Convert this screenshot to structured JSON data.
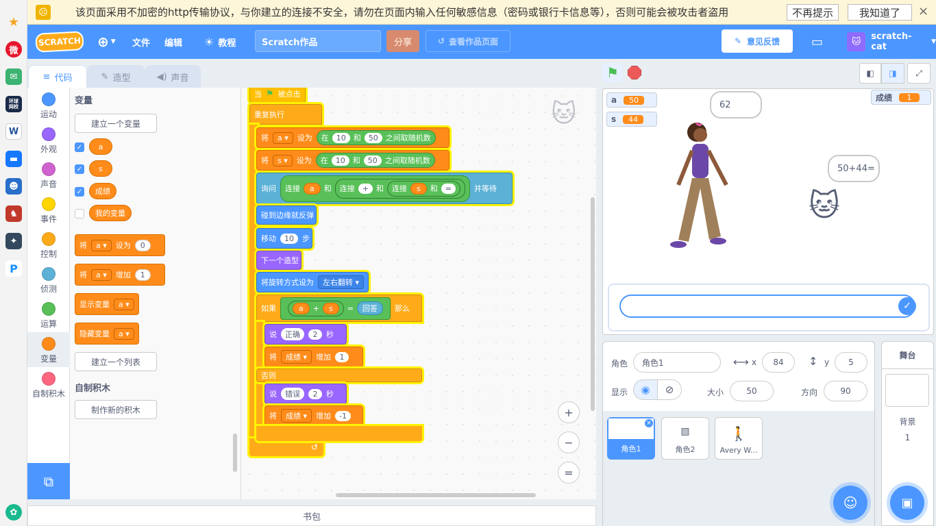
{
  "browser": {
    "warning_text": "该页面采用不加密的http传输协议，与你建立的连接不安全，请勿在页面内输入任何敏感信息（密码或银行卡信息等），否则可能会被攻击者盗用",
    "btn_no_remind": "不再提示",
    "btn_got_it": "我知道了",
    "close": "×",
    "side_icons": [
      "star-icon",
      "weibo-icon",
      "mail-icon",
      "news-icon",
      "word-icon",
      "chat-icon",
      "game-icon",
      "game2-icon",
      "game3-icon",
      "p-icon"
    ],
    "side_labels": {
      "news": "环球\n网校"
    }
  },
  "menubar": {
    "logo": "SCRATCH",
    "file": "文件",
    "edit": "编辑",
    "tutorials": "教程",
    "project_title": "Scratch作品",
    "share": "分享",
    "see_project": "查看作品页面",
    "feedback": "意见反馈",
    "username": "scratch-cat"
  },
  "tabs": {
    "code": "代码",
    "costumes": "造型",
    "sounds": "声音"
  },
  "categories": [
    {
      "label": "运动",
      "color": "#4c97ff"
    },
    {
      "label": "外观",
      "color": "#9966ff"
    },
    {
      "label": "声音",
      "color": "#cf63cf"
    },
    {
      "label": "事件",
      "color": "#ffd500"
    },
    {
      "label": "控制",
      "color": "#ffab19"
    },
    {
      "label": "侦测",
      "color": "#5cb1d6"
    },
    {
      "label": "运算",
      "color": "#59c059"
    },
    {
      "label": "变量",
      "color": "#ff8c1a"
    },
    {
      "label": "自制积木",
      "color": "#ff6680"
    }
  ],
  "palette": {
    "heading_vars": "变量",
    "make_var": "建立一个变量",
    "vars": [
      "a",
      "s",
      "成绩",
      "我的变量"
    ],
    "set_label": "将",
    "set_to": "设为",
    "set_value": "0",
    "change_label": "将",
    "change_by": "增加",
    "change_value": "1",
    "show_var": "显示变量",
    "hide_var": "隐藏变量",
    "dd_var": "a",
    "make_list": "建立一个列表",
    "heading_my": "自制积木",
    "make_block": "制作新的积木"
  },
  "script": {
    "when_flag": "当",
    "clicked": "被点击",
    "forever": "重复执行",
    "set": "将",
    "var_a": "a",
    "var_s": "s",
    "set_to": "设为",
    "pick_in": "在",
    "and": "和",
    "pick_between": "之间取随机数",
    "min": "10",
    "max": "50",
    "ask": "询问",
    "join": "连接",
    "plus": "+",
    "equals": "=",
    "and_wait": "并等待",
    "bounce": "碰到边缘就反弹",
    "move": "移动",
    "move_steps": "10",
    "steps": "步",
    "next_costume": "下一个造型",
    "rotation": "将旋转方式设为",
    "rotation_val": "左右翻转",
    "if": "如果",
    "answer": "回答",
    "then": "那么",
    "say": "说",
    "correct": "正确",
    "wrong": "错误",
    "secs_val": "2",
    "secs": "秒",
    "score": "成绩",
    "change": "增加",
    "plus_one": "1",
    "minus_one": "-1",
    "else": "否则"
  },
  "zoom": {
    "in": "+",
    "out": "−",
    "reset": "="
  },
  "backpack": "书包",
  "stage": {
    "monitors": [
      {
        "name": "a",
        "value": "50"
      },
      {
        "name": "s",
        "value": "44"
      },
      {
        "name": "成绩",
        "value": "1"
      }
    ],
    "bubble_girl": "62",
    "bubble_cat": "50+44=",
    "ask_input": ""
  },
  "sprite_info": {
    "sprite_label": "角色",
    "sprite_name": "角色1",
    "x_label": "x",
    "x": "84",
    "y_label": "y",
    "y": "5",
    "show_label": "显示",
    "size_label": "大小",
    "size": "50",
    "dir_label": "方向",
    "direction": "90",
    "sprites": [
      "角色1",
      "角色2",
      "Avery W..."
    ]
  },
  "stage_pane": {
    "title": "舞台",
    "backdrop_label": "背景",
    "backdrop_count": "1"
  }
}
